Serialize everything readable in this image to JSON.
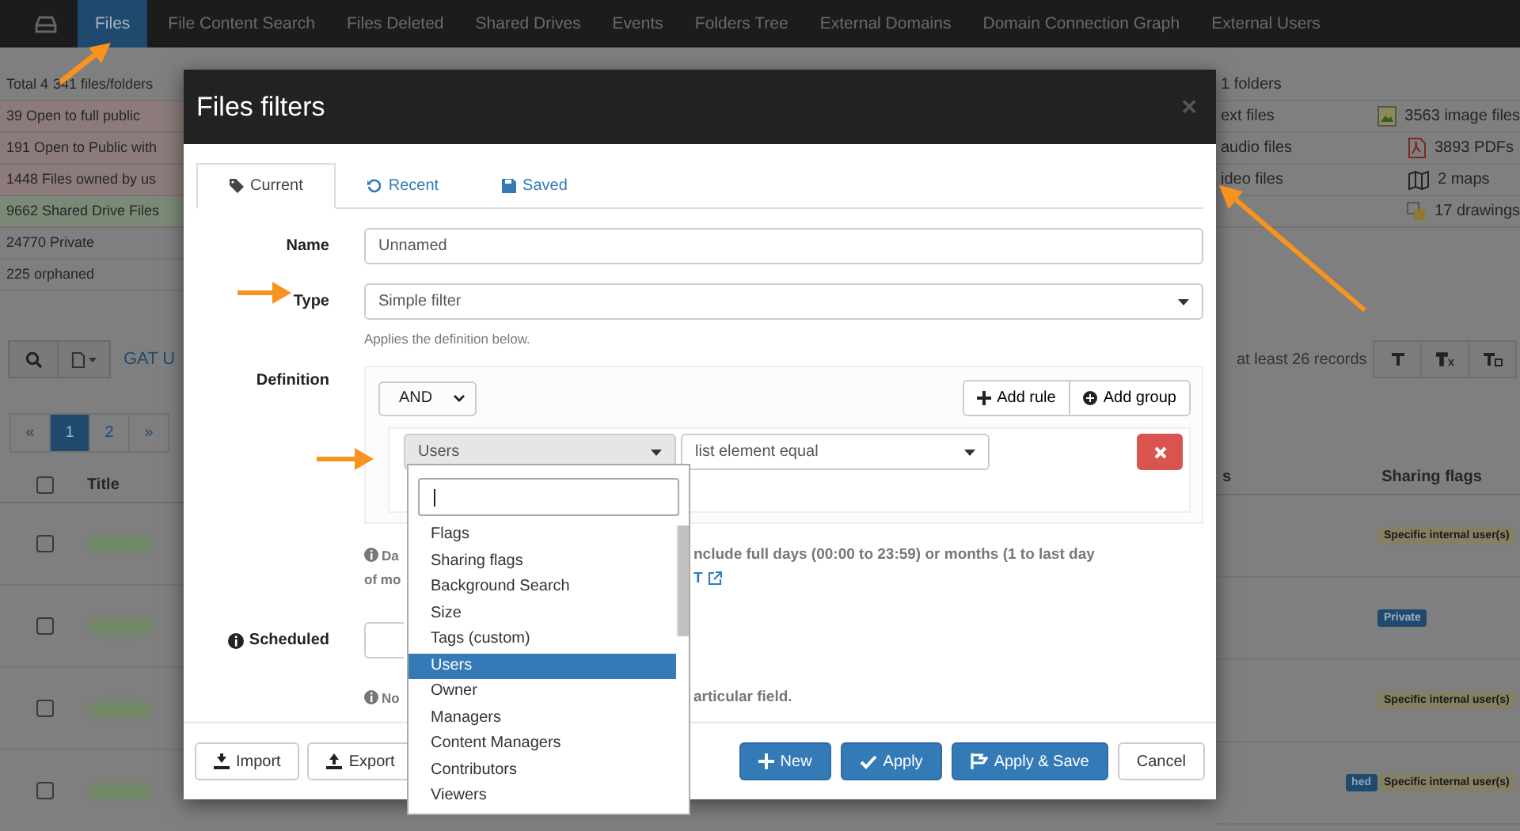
{
  "nav": {
    "tabs": [
      {
        "label": "Files",
        "selected": true
      },
      {
        "label": "File Content Search",
        "selected": false
      },
      {
        "label": "Files Deleted",
        "selected": false
      },
      {
        "label": "Shared Drives",
        "selected": false
      },
      {
        "label": "Events",
        "selected": false
      },
      {
        "label": "Folders Tree",
        "selected": false
      },
      {
        "label": "External Domains",
        "selected": false
      },
      {
        "label": "Domain Connection Graph",
        "selected": false
      },
      {
        "label": "External Users",
        "selected": false
      }
    ]
  },
  "stats": {
    "total": "Total 4",
    "total_rest": "341 files/folders",
    "left_rows": [
      {
        "text": "39 Open to full public",
        "color": "#8c7b7a"
      },
      {
        "text": "191 Open to Public with",
        "color": "#8c7b7a"
      },
      {
        "text": "1448 Files owned by us",
        "color": "#8c7b7a"
      },
      {
        "text": "9662 Shared Drive Files",
        "color": "#7b8a77"
      },
      {
        "text": "24770 Private"
      },
      {
        "text": "225 orphaned"
      }
    ],
    "right_rows": [
      {
        "column_1": "1 folders"
      },
      {
        "column_1": "ext files",
        "column_2": "3563 image files",
        "kind": "image"
      },
      {
        "column_1": "audio files",
        "column_2": "3893 PDFs",
        "kind": "pdf"
      },
      {
        "column_1": "ideo files",
        "column_2": "2 maps",
        "kind": "map"
      },
      {
        "column_2": "17 drawings",
        "kind": "drawing"
      }
    ]
  },
  "toolbar": {
    "label": "GAT U",
    "records": "at least 26 records"
  },
  "pagination": [
    {
      "label": "«",
      "selected": false
    },
    {
      "label": "1",
      "selected": true
    },
    {
      "label": "2",
      "selected": false
    },
    {
      "label": "»",
      "selected": false
    }
  ],
  "table": {
    "all_checked": false,
    "columns": [
      "Title",
      "s",
      "Sharing flags"
    ],
    "rows": [
      {
        "checked": false,
        "flag": "Specific internal user(s)",
        "color": "#857f63"
      },
      {
        "checked": false,
        "flag": "Private",
        "color": "#1f4a6e"
      },
      {
        "checked": false,
        "flag": "Specific internal user(s)",
        "color": "#857f63"
      },
      {
        "checked": false,
        "column_2": "hed",
        "flag": "Specific internal user(s)",
        "color": "#857f63"
      }
    ]
  },
  "modal": {
    "title": "Files filters",
    "close": "×",
    "tabs": [
      {
        "label": "Current",
        "selected": true
      },
      {
        "label": "Recent",
        "selected": false
      },
      {
        "label": "Saved",
        "selected": false
      }
    ],
    "name_label": "Name",
    "name_value": "Unnamed",
    "type_label": "Type",
    "type_value": "Simple filter",
    "type_help": "Applies the definition below.",
    "definition_label": "Definition",
    "condition": "AND",
    "add_rule": "Add rule",
    "add_group": "Add group",
    "rule_field": "Users",
    "rule_operator": "list element equal",
    "help_1a": "Da",
    "help_1b": "nclude full days (00:00 to 23:59) or months (1 to last day",
    "help_2a": "of mo",
    "help_2b": "T",
    "scheduled_label": "Scheduled",
    "note_a": "No",
    "note_b": "articular field.",
    "footer_left": [
      "Import",
      "Export"
    ],
    "footer_right": [
      {
        "label": "New",
        "kind": "primary"
      },
      {
        "label": "Apply",
        "kind": "primary"
      },
      {
        "label": "Apply & Save",
        "kind": "primary"
      },
      {
        "label": "Cancel",
        "kind": "default"
      }
    ]
  },
  "dropdown": {
    "items": [
      {
        "label": "Flags",
        "selected": false
      },
      {
        "label": "Sharing flags",
        "selected": false
      },
      {
        "label": "Background Search",
        "selected": false
      },
      {
        "label": "Size",
        "selected": false
      },
      {
        "label": "Tags (custom)",
        "selected": false
      },
      {
        "label": "Users",
        "selected": true
      },
      {
        "label": "Owner",
        "selected": false
      },
      {
        "label": "Managers",
        "selected": false
      },
      {
        "label": "Content Managers",
        "selected": false
      },
      {
        "label": "Contributors",
        "selected": false
      },
      {
        "label": "Viewers",
        "selected": false
      }
    ]
  }
}
